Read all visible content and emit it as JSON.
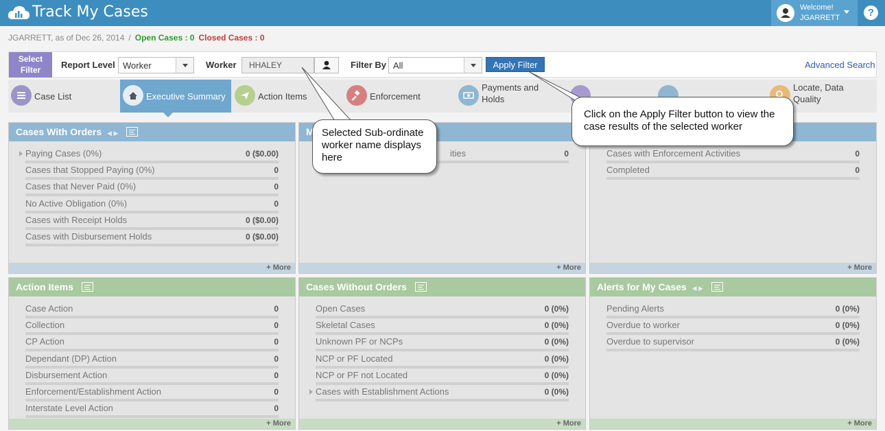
{
  "header": {
    "app_title": "Track My Cases",
    "welcome_label": "Welcome!",
    "user": "JGARRETT",
    "help": "?"
  },
  "status": {
    "user_date": "JGARRETT, as of Dec 26, 2014",
    "separator": "/",
    "open_cases": "Open Cases : 0",
    "closed_cases": "Closed Cases : 0"
  },
  "filter": {
    "select_filter": [
      "Select",
      "Filter"
    ],
    "report_level_label": "Report Level",
    "report_level_value": "Worker",
    "worker_label": "Worker",
    "worker_value": "HHALEY",
    "filter_by_label": "Filter By",
    "filter_by_value": "All",
    "apply_label": "Apply Filter",
    "advanced_search": "Advanced Search"
  },
  "tabs": [
    {
      "label": "Case List",
      "icon": "list-icon",
      "color": "#9a94c9"
    },
    {
      "label": "Executive Summary",
      "icon": "home-icon",
      "color": "#e6eef5"
    },
    {
      "label": "Action Items",
      "icon": "send-icon",
      "color": "#b6cf8f"
    },
    {
      "label": "Enforcement",
      "icon": "gavel-icon",
      "color": "#d77f7f"
    },
    {
      "label": "Payments and Holds",
      "icon": "money-icon",
      "color": "#8fb6d2"
    },
    {
      "label": "Locate, Data Quality",
      "icon": "search-icon",
      "color": "#e9b978"
    }
  ],
  "panels": {
    "cases_with_orders": {
      "title": "Cases With Orders",
      "nav": "◀ ▶",
      "rows": [
        {
          "label": "Paying Cases (0%)",
          "value": "0 ($0.00)"
        },
        {
          "label": "Cases that Stopped Paying (0%)",
          "value": "0"
        },
        {
          "label": "Cases that Never Paid (0%)",
          "value": "0"
        },
        {
          "label": "No Active Obligation (0%)",
          "value": "0"
        },
        {
          "label": "Cases with Receipt Holds",
          "value": "0 ($0.00)"
        },
        {
          "label": "Cases with Disbursement Holds",
          "value": "0 ($0.00)"
        }
      ],
      "more": "+ More"
    },
    "middle_top": {
      "title": "M",
      "rows": [
        {
          "label": "ities",
          "value": "0"
        }
      ],
      "more": "+ More"
    },
    "right_top": {
      "rows": [
        {
          "label": "Cases with Enforcement Activities",
          "value": "0"
        },
        {
          "label": "Completed",
          "value": "0"
        }
      ],
      "more": "+ More"
    },
    "action_items": {
      "title": "Action Items",
      "rows": [
        {
          "label": "Case Action",
          "value": "0"
        },
        {
          "label": "Collection",
          "value": "0"
        },
        {
          "label": "CP Action",
          "value": "0"
        },
        {
          "label": "Dependant (DP) Action",
          "value": "0"
        },
        {
          "label": "Disbursement Action",
          "value": "0"
        },
        {
          "label": "Enforcement/Establishment Action",
          "value": "0"
        },
        {
          "label": "Interstate Level Action",
          "value": "0"
        }
      ],
      "more": "+ More"
    },
    "cases_without_orders": {
      "title": "Cases Without Orders",
      "rows": [
        {
          "label": "Open Cases",
          "value": "0 (0%)"
        },
        {
          "label": "Skeletal Cases",
          "value": "0 (0%)"
        },
        {
          "label": "Unknown PF or NCPs",
          "value": "0 (0%)"
        },
        {
          "label": "NCP or PF Located",
          "value": "0 (0%)"
        },
        {
          "label": "NCP or PF not Located",
          "value": "0 (0%)"
        },
        {
          "label": "Cases with Establishment Actions",
          "value": "0 (0%)"
        }
      ],
      "more": "+ More"
    },
    "alerts": {
      "title": "Alerts for My Cases",
      "nav": "◀ ▶",
      "rows": [
        {
          "label": "Pending Alerts",
          "value": "0 (0%)"
        },
        {
          "label": "Overdue to worker",
          "value": "0 (0%)"
        },
        {
          "label": "Overdue to supervisor",
          "value": "0 (0%)"
        }
      ],
      "more": "+ More"
    }
  },
  "callouts": {
    "worker_note": "Selected Sub-ordinate worker name displays here",
    "apply_note": "Click on the Apply Filter button to view the case results of the selected worker"
  }
}
